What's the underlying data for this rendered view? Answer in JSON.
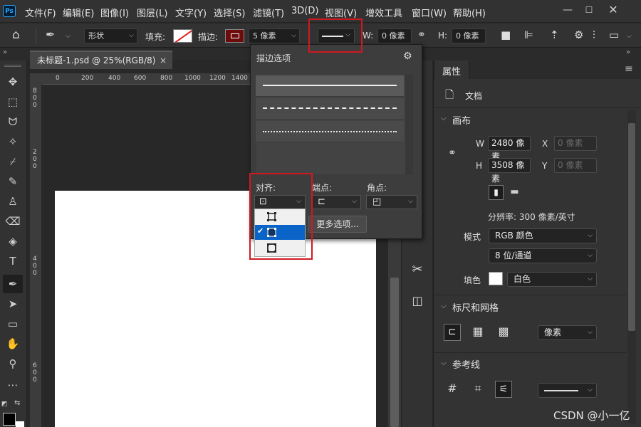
{
  "app_logo": "Ps",
  "menu": [
    "文件(F)",
    "编辑(E)",
    "图像(I)",
    "图层(L)",
    "文字(Y)",
    "选择(S)",
    "滤镜(T)",
    "3D(D)",
    "视图(V)",
    "增效工具",
    "窗口(W)",
    "帮助(H)"
  ],
  "options": {
    "tool_mode": "形状",
    "fill_label": "填充:",
    "stroke_label": "描边:",
    "stroke_width": "5 像素",
    "w_label": "W:",
    "w_value": "0 像素",
    "h_label": "H:",
    "h_value": "0 像素"
  },
  "document_tab": {
    "title": "未标题-1.psd @ 25%(RGB/8)",
    "close": "×"
  },
  "ruler_h_ticks": [
    "0",
    "200",
    "400",
    "600",
    "800",
    "1000",
    "1200",
    "1400"
  ],
  "ruler_v_ticks": [
    "8",
    "0",
    "0",
    "2",
    "0",
    "0",
    "4",
    "0",
    "0",
    "6",
    "0",
    "0"
  ],
  "stroke_popup": {
    "title": "描边选项",
    "align_label": "对齐:",
    "caps_label": "端点:",
    "corners_label": "角点:",
    "more_button": "更多选项..."
  },
  "properties": {
    "tab": "属性",
    "doc_label": "文档",
    "canvas_section": "画布",
    "w_label": "W",
    "w_value": "2480 像素",
    "x_label": "X",
    "x_value": "0 像素",
    "h_label": "H",
    "h_value": "3508 像素",
    "y_label": "Y",
    "y_value": "0 像素",
    "resolution": "分辨率: 300 像素/英寸",
    "mode_label": "模式",
    "mode_value": "RGB 颜色",
    "depth_value": "8 位/通道",
    "fill_label": "填色",
    "fill_value": "白色",
    "rulers_section": "标尺和网格",
    "ruler_units": "像素",
    "guides_section": "参考线"
  },
  "watermark": "CSDN @小一亿"
}
